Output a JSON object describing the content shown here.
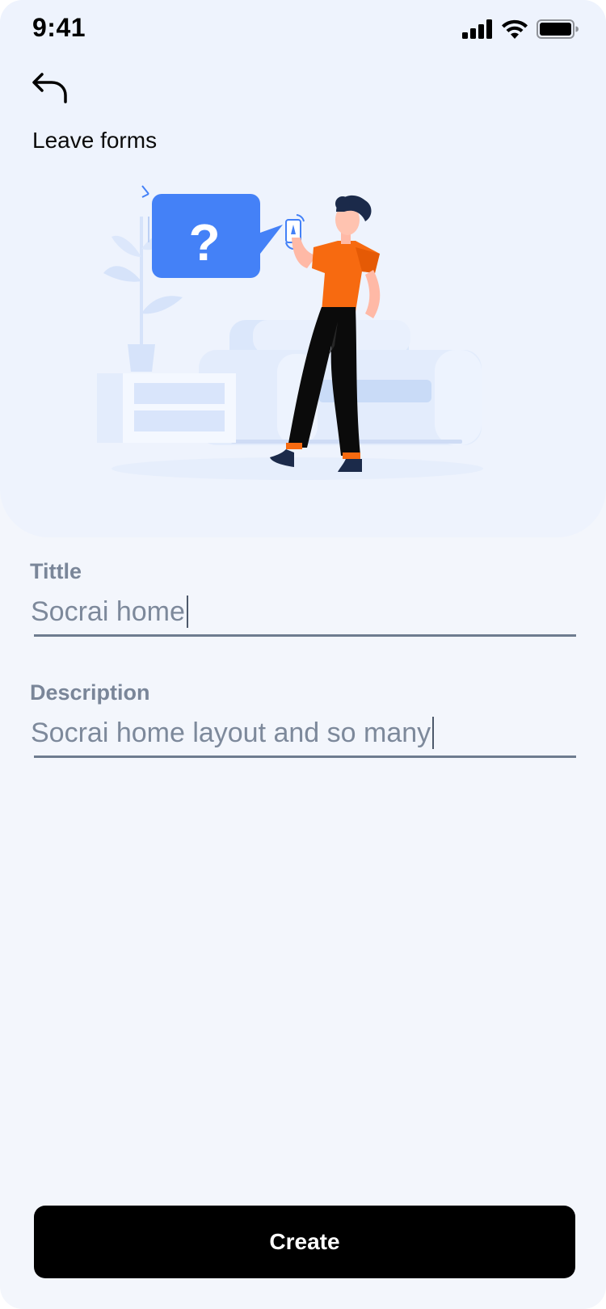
{
  "status_bar": {
    "time": "9:41"
  },
  "header": {
    "title": "Leave forms"
  },
  "form": {
    "title_label": "Tittle",
    "title_value": "Socrai home",
    "description_label": "Description",
    "description_value": "Socrai home  layout and so many"
  },
  "actions": {
    "create_label": "Create"
  },
  "icons": {
    "back": "undo-arrow-icon",
    "signal": "cellular-signal-icon",
    "wifi": "wifi-icon",
    "battery": "battery-icon"
  },
  "colors": {
    "accent_blue": "#4481f7",
    "shirt_orange": "#f76a10",
    "button_bg": "#000000",
    "label_gray": "#7a8699"
  }
}
